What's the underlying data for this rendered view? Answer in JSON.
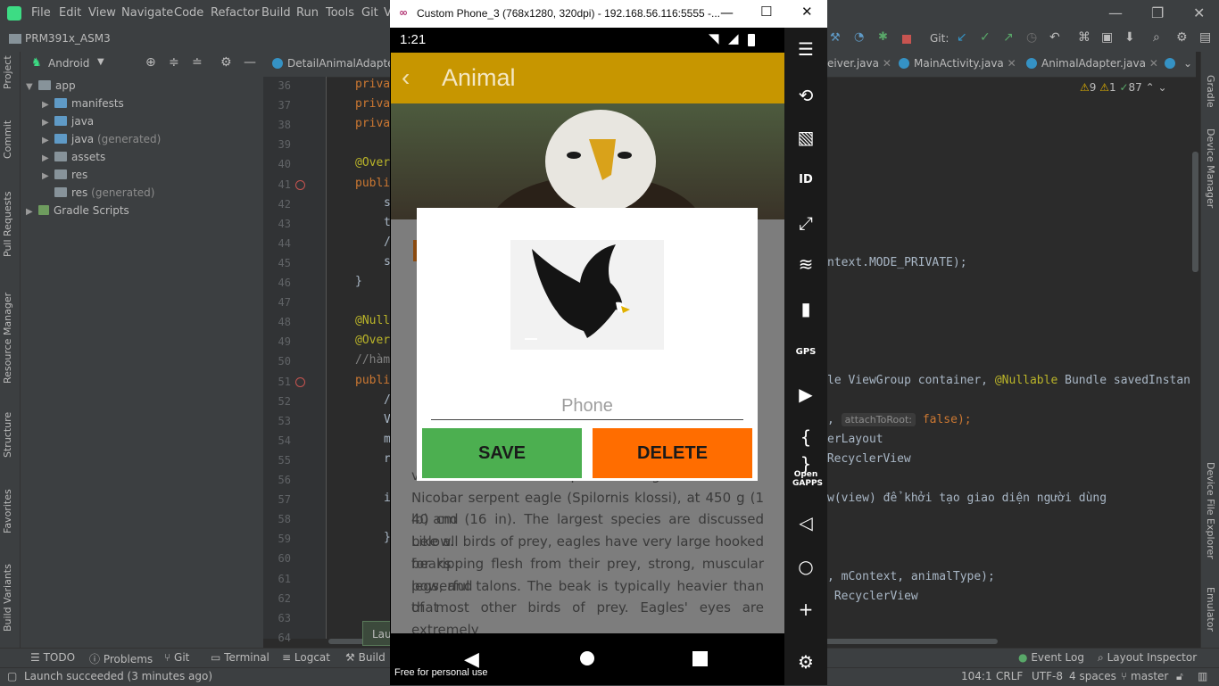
{
  "ide": {
    "menu": [
      "File",
      "Edit",
      "View",
      "Navigate",
      "Code",
      "Refactor",
      "Build",
      "Run",
      "Tools",
      "Git",
      "V"
    ],
    "project_name": "PRM391x_ASM3",
    "git_label": "Git:",
    "panel_view": "Android",
    "tree": [
      {
        "label": "app",
        "extra": ""
      },
      {
        "label": "manifests",
        "extra": ""
      },
      {
        "label": "java",
        "extra": ""
      },
      {
        "label": "java",
        "extra": "(generated)"
      },
      {
        "label": "assets",
        "extra": ""
      },
      {
        "label": "res",
        "extra": ""
      },
      {
        "label": "res",
        "extra": "(generated)"
      },
      {
        "label": "Gradle Scripts",
        "extra": ""
      }
    ],
    "tabs": [
      "DetailAnimalAdapter.j",
      "eiver.java",
      "MainActivity.java",
      "AnimalAdapter.java"
    ],
    "inspections": {
      "warnings": "9",
      "weak": "1",
      "ok": "87"
    },
    "line_numbers": [
      "36",
      "37",
      "38",
      "39",
      "40",
      "41",
      "42",
      "43",
      "44",
      "45",
      "46",
      "47",
      "48",
      "49",
      "50",
      "51",
      "52",
      "53",
      "54",
      "55",
      "56",
      "57",
      "58",
      "59",
      "60",
      "61",
      "62",
      "63",
      "64"
    ],
    "code_left": [
      "priva",
      "priva",
      "priva",
      "",
      "@Over",
      "publi",
      "s",
      "t",
      "/",
      "s",
      "}",
      "",
      "@Null",
      "@Over",
      "//hàm",
      "publi",
      "/",
      "V",
      "m",
      "r",
      "",
      "i",
      "",
      "}",
      "",
      "",
      "",
      "",
      ""
    ],
    "code_right": {
      "l45": "ntext.MODE_PRIVATE);",
      "l51a": "le ViewGroup container, ",
      "l51b": "@Nullable",
      "l51c": " Bundle savedInstan",
      "l53_hint": "attachToRoot:",
      "l53_val": "false);",
      "l54": "erLayout",
      "l55": " RecyclerView",
      "l57": "w(view) để khởi tạo giao diện người dùng",
      "l61": ", mContext, animalType);",
      "l62": " RecyclerView"
    },
    "left_tool_tabs": [
      "Project",
      "Commit",
      "Pull Requests",
      "Resource Manager",
      "Structure",
      "Favorites",
      "Build Variants"
    ],
    "right_tool_tabs": [
      "Gradle",
      "Device Manager",
      "Device File Explorer",
      "Emulator"
    ],
    "bottom_tools": [
      "TODO",
      "Problems",
      "Git",
      "Terminal",
      "Logcat",
      "Build",
      "Event Log",
      "Layout Inspector"
    ],
    "launch_popup": "Lau",
    "status_message": "Launch succeeded (3 minutes ago)",
    "status_right": [
      "104:1",
      "CRLF",
      "UTF-8",
      "4 spaces",
      "master"
    ]
  },
  "emulator": {
    "window_title": "Custom Phone_3 (768x1280, 320dpi) - 192.168.56.116:5555 -...",
    "time": "1:21",
    "app_title": "Animal",
    "description": [
      "vultures. The smallest species of eagle is the South",
      "Nicobar serpent eagle (Spilornis klossi), at 450 g (1 lb) and",
      "40 cm (16 in). The largest species are discussed below.",
      "Like all birds of prey, eagles have very large hooked beaks",
      "for ripping flesh from their prey, strong, muscular legs, and",
      "powerful talons. The beak is typically heavier than that",
      "of most other birds of prey. Eagles' eyes are extremely"
    ],
    "dialog": {
      "phone_placeholder": "Phone",
      "save_label": "SAVE",
      "delete_label": "DELETE",
      "save_color": "#4caf50",
      "delete_color": "#ff6d00"
    },
    "watermark": "Free for personal use",
    "side_tools": [
      "menu-icon",
      "rotate-icon",
      "screenshot-icon",
      "id-icon",
      "fit-icon",
      "rss-icon",
      "sd-card-icon",
      "gps-icon",
      "screen-record-icon",
      "code-icon",
      "opengapps-icon",
      "back-icon",
      "home-icon",
      "add-icon",
      "settings-icon"
    ],
    "gps_label": "GPS",
    "opengapps_label": "Open GAPPS"
  }
}
